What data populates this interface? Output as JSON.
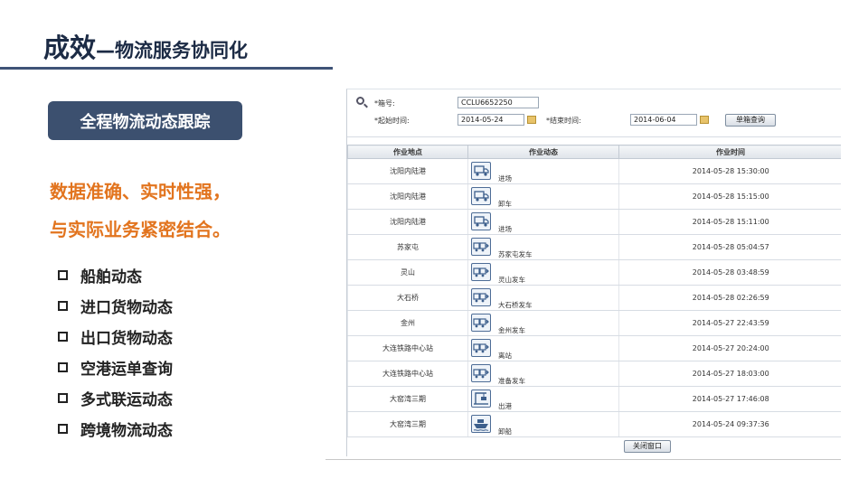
{
  "slide": {
    "title_main": "成效",
    "title_sub": "—物流服务协同化",
    "badge": "全程物流动态跟踪",
    "highlight_line1": "数据准确、实时性强，",
    "highlight_line2": "与实际业务紧密结合。",
    "bullets": [
      "船舶动态",
      "进口货物动态",
      "出口货物动态",
      "空港运单查询",
      "多式联运动态",
      "跨境物流动态"
    ]
  },
  "colors": {
    "title": "#1c2b45",
    "accent_bar": "#3f5377",
    "badge_bg": "#3c506f",
    "highlight": "#e2741e"
  },
  "query_form": {
    "box_label": "*箱号:",
    "box_value": "CCLU6652250",
    "start_label": "*起始时间:",
    "start_value": "2014-05-24",
    "end_label": "*结束时间:",
    "end_value": "2014-06-04",
    "query_button": "单箱查询"
  },
  "table": {
    "headers": [
      "作业地点",
      "作业动态",
      "作业时间"
    ],
    "rows": [
      {
        "location": "沈阳内陆港",
        "event": "进场",
        "icon": "container-truck-icon",
        "time": "2014-05-28 15:30:00"
      },
      {
        "location": "沈阳内陆港",
        "event": "卸车",
        "icon": "container-truck-icon",
        "time": "2014-05-28 15:15:00"
      },
      {
        "location": "沈阳内陆港",
        "event": "进场",
        "icon": "container-truck-icon",
        "time": "2014-05-28 15:11:00"
      },
      {
        "location": "苏家屯",
        "event": "苏家屯发车",
        "icon": "train-icon",
        "time": "2014-05-28 05:04:57"
      },
      {
        "location": "灵山",
        "event": "灵山发车",
        "icon": "train-icon",
        "time": "2014-05-28 03:48:59"
      },
      {
        "location": "大石桥",
        "event": "大石桥发车",
        "icon": "train-icon",
        "time": "2014-05-28 02:26:59"
      },
      {
        "location": "金州",
        "event": "金州发车",
        "icon": "train-icon",
        "time": "2014-05-27 22:43:59"
      },
      {
        "location": "大连铁路中心站",
        "event": "离站",
        "icon": "train-icon",
        "time": "2014-05-27 20:24:00"
      },
      {
        "location": "大连铁路中心站",
        "event": "准备发车",
        "icon": "train-icon",
        "time": "2014-05-27 18:03:00"
      },
      {
        "location": "大窑湾三期",
        "event": "出港",
        "icon": "crane-icon",
        "time": "2014-05-27 17:46:08"
      },
      {
        "location": "大窑湾三期",
        "event": "卸船",
        "icon": "ship-icon",
        "time": "2014-05-24 09:37:36"
      }
    ]
  },
  "close_button": "关闭窗口"
}
